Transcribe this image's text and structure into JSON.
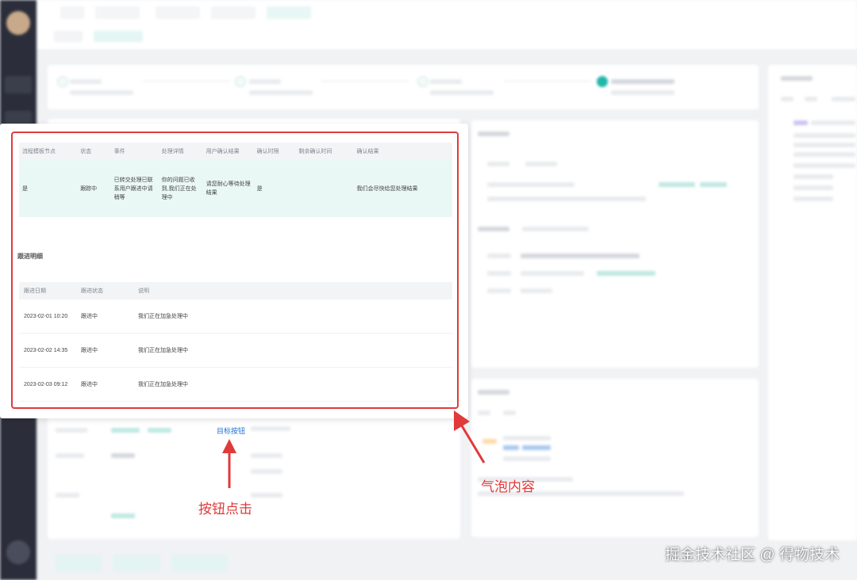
{
  "table1": {
    "headers": [
      "流程模板节点",
      "状态",
      "事件",
      "处理详情",
      "用户确认结果",
      "确认时限",
      "剩余确认时间",
      "确认结果"
    ],
    "row": [
      "是",
      "跟踪中",
      "已转交处理已联系用户跟进中请稍等",
      "你的问题已收到,我们正在处理中",
      "请您耐心等待处理结果",
      "是",
      "",
      "我们会尽快给您处理结果"
    ]
  },
  "section2_title": "跟进明细",
  "table2": {
    "headers": [
      "跟进日期",
      "跟进状态",
      "说明"
    ],
    "rows": [
      [
        "2023-02-01 10:20",
        "跟进中",
        "我们正在加急处理中"
      ],
      [
        "2023-02-02 14:35",
        "跟进中",
        "我们正在加急处理中"
      ],
      [
        "2023-02-03 09:12",
        "跟进中",
        "我们正在加急处理中"
      ]
    ]
  },
  "target_button": "目标按钮",
  "annotations": {
    "button_click": "按钮点击",
    "bubble_content": "气泡内容"
  },
  "watermark": "掘金技术社区 @ 得物技术",
  "colors": {
    "highlight": "#e03a3a",
    "accent": "#21b6a8",
    "link": "#1e6fd9"
  }
}
